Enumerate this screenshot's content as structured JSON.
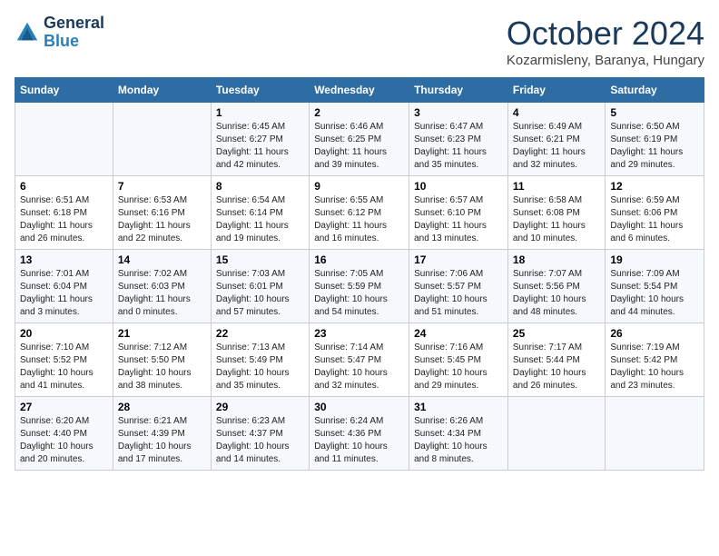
{
  "logo": {
    "line1": "General",
    "line2": "Blue"
  },
  "title": "October 2024",
  "location": "Kozarmisleny, Baranya, Hungary",
  "weekdays": [
    "Sunday",
    "Monday",
    "Tuesday",
    "Wednesday",
    "Thursday",
    "Friday",
    "Saturday"
  ],
  "weeks": [
    [
      {
        "day": "",
        "info": ""
      },
      {
        "day": "",
        "info": ""
      },
      {
        "day": "1",
        "info": "Sunrise: 6:45 AM\nSunset: 6:27 PM\nDaylight: 11 hours and 42 minutes."
      },
      {
        "day": "2",
        "info": "Sunrise: 6:46 AM\nSunset: 6:25 PM\nDaylight: 11 hours and 39 minutes."
      },
      {
        "day": "3",
        "info": "Sunrise: 6:47 AM\nSunset: 6:23 PM\nDaylight: 11 hours and 35 minutes."
      },
      {
        "day": "4",
        "info": "Sunrise: 6:49 AM\nSunset: 6:21 PM\nDaylight: 11 hours and 32 minutes."
      },
      {
        "day": "5",
        "info": "Sunrise: 6:50 AM\nSunset: 6:19 PM\nDaylight: 11 hours and 29 minutes."
      }
    ],
    [
      {
        "day": "6",
        "info": "Sunrise: 6:51 AM\nSunset: 6:18 PM\nDaylight: 11 hours and 26 minutes."
      },
      {
        "day": "7",
        "info": "Sunrise: 6:53 AM\nSunset: 6:16 PM\nDaylight: 11 hours and 22 minutes."
      },
      {
        "day": "8",
        "info": "Sunrise: 6:54 AM\nSunset: 6:14 PM\nDaylight: 11 hours and 19 minutes."
      },
      {
        "day": "9",
        "info": "Sunrise: 6:55 AM\nSunset: 6:12 PM\nDaylight: 11 hours and 16 minutes."
      },
      {
        "day": "10",
        "info": "Sunrise: 6:57 AM\nSunset: 6:10 PM\nDaylight: 11 hours and 13 minutes."
      },
      {
        "day": "11",
        "info": "Sunrise: 6:58 AM\nSunset: 6:08 PM\nDaylight: 11 hours and 10 minutes."
      },
      {
        "day": "12",
        "info": "Sunrise: 6:59 AM\nSunset: 6:06 PM\nDaylight: 11 hours and 6 minutes."
      }
    ],
    [
      {
        "day": "13",
        "info": "Sunrise: 7:01 AM\nSunset: 6:04 PM\nDaylight: 11 hours and 3 minutes."
      },
      {
        "day": "14",
        "info": "Sunrise: 7:02 AM\nSunset: 6:03 PM\nDaylight: 11 hours and 0 minutes."
      },
      {
        "day": "15",
        "info": "Sunrise: 7:03 AM\nSunset: 6:01 PM\nDaylight: 10 hours and 57 minutes."
      },
      {
        "day": "16",
        "info": "Sunrise: 7:05 AM\nSunset: 5:59 PM\nDaylight: 10 hours and 54 minutes."
      },
      {
        "day": "17",
        "info": "Sunrise: 7:06 AM\nSunset: 5:57 PM\nDaylight: 10 hours and 51 minutes."
      },
      {
        "day": "18",
        "info": "Sunrise: 7:07 AM\nSunset: 5:56 PM\nDaylight: 10 hours and 48 minutes."
      },
      {
        "day": "19",
        "info": "Sunrise: 7:09 AM\nSunset: 5:54 PM\nDaylight: 10 hours and 44 minutes."
      }
    ],
    [
      {
        "day": "20",
        "info": "Sunrise: 7:10 AM\nSunset: 5:52 PM\nDaylight: 10 hours and 41 minutes."
      },
      {
        "day": "21",
        "info": "Sunrise: 7:12 AM\nSunset: 5:50 PM\nDaylight: 10 hours and 38 minutes."
      },
      {
        "day": "22",
        "info": "Sunrise: 7:13 AM\nSunset: 5:49 PM\nDaylight: 10 hours and 35 minutes."
      },
      {
        "day": "23",
        "info": "Sunrise: 7:14 AM\nSunset: 5:47 PM\nDaylight: 10 hours and 32 minutes."
      },
      {
        "day": "24",
        "info": "Sunrise: 7:16 AM\nSunset: 5:45 PM\nDaylight: 10 hours and 29 minutes."
      },
      {
        "day": "25",
        "info": "Sunrise: 7:17 AM\nSunset: 5:44 PM\nDaylight: 10 hours and 26 minutes."
      },
      {
        "day": "26",
        "info": "Sunrise: 7:19 AM\nSunset: 5:42 PM\nDaylight: 10 hours and 23 minutes."
      }
    ],
    [
      {
        "day": "27",
        "info": "Sunrise: 6:20 AM\nSunset: 4:40 PM\nDaylight: 10 hours and 20 minutes."
      },
      {
        "day": "28",
        "info": "Sunrise: 6:21 AM\nSunset: 4:39 PM\nDaylight: 10 hours and 17 minutes."
      },
      {
        "day": "29",
        "info": "Sunrise: 6:23 AM\nSunset: 4:37 PM\nDaylight: 10 hours and 14 minutes."
      },
      {
        "day": "30",
        "info": "Sunrise: 6:24 AM\nSunset: 4:36 PM\nDaylight: 10 hours and 11 minutes."
      },
      {
        "day": "31",
        "info": "Sunrise: 6:26 AM\nSunset: 4:34 PM\nDaylight: 10 hours and 8 minutes."
      },
      {
        "day": "",
        "info": ""
      },
      {
        "day": "",
        "info": ""
      }
    ]
  ]
}
